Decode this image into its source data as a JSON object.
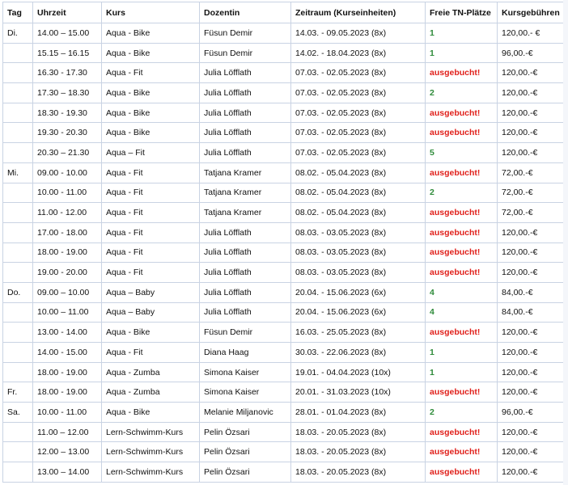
{
  "table": {
    "headers": {
      "day": "Tag",
      "time": "Uhrzeit",
      "course": "Kurs",
      "instructor": "Dozentin",
      "period": "Zeitraum (Kurseinheiten)",
      "spots": "Freie TN-Plätze",
      "fee": "Kursgebühren"
    },
    "rows": [
      {
        "day": "Di.",
        "time": "14.00 – 15.00",
        "course": "Aqua - Bike",
        "instructor": "Füsun Demir",
        "period": "14.03. - 09.05.2023 (8x)",
        "spots": "1",
        "fee": "120,00.- €",
        "status": "free"
      },
      {
        "day": "",
        "time": "15.15 – 16.15",
        "course": "Aqua - Bike",
        "instructor": "Füsun Demir",
        "period": "14.02. - 18.04.2023 (8x)",
        "spots": "1",
        "fee": "96,00.-€",
        "status": "free"
      },
      {
        "day": "",
        "time": "16.30 - 17.30",
        "course": "Aqua - Fit",
        "instructor": "Julia Löfflath",
        "period": "07.03. - 02.05.2023 (8x)",
        "spots": "ausgebucht!",
        "fee": "120,00.-€",
        "status": "full"
      },
      {
        "day": "",
        "time": "17.30 – 18.30",
        "course": "Aqua - Bike",
        "instructor": "Julia Löfflath",
        "period": "07.03. - 02.05.2023 (8x)",
        "spots": "2",
        "fee": "120,00.-€",
        "status": "free"
      },
      {
        "day": "",
        "time": "18.30 - 19.30",
        "course": "Aqua - Bike",
        "instructor": "Julia Löfflath",
        "period": "07.03. - 02.05.2023 (8x)",
        "spots": "ausgebucht!",
        "fee": "120,00.-€",
        "status": "full"
      },
      {
        "day": "",
        "time": "19.30 - 20.30",
        "course": "Aqua - Bike",
        "instructor": "Julia Löfflath",
        "period": "07.03. - 02.05.2023 (8x)",
        "spots": "ausgebucht!",
        "fee": "120,00.-€",
        "status": "full"
      },
      {
        "day": "",
        "time": "20.30 – 21.30",
        "course": "Aqua – Fit",
        "instructor": "Julia Löfflath",
        "period": "07.03. - 02.05.2023 (8x)",
        "spots": "5",
        "fee": "120,00.-€",
        "status": "free"
      },
      {
        "day": "Mi.",
        "time": "09.00 - 10.00",
        "course": "Aqua - Fit",
        "instructor": "Tatjana Kramer",
        "period": "08.02. - 05.04.2023 (8x)",
        "spots": "ausgebucht!",
        "fee": "72,00.-€",
        "status": "full"
      },
      {
        "day": "",
        "time": "10.00 - 11.00",
        "course": "Aqua - Fit",
        "instructor": "Tatjana Kramer",
        "period": "08.02. - 05.04.2023 (8x)",
        "spots": "2",
        "fee": "72,00.-€",
        "status": "free"
      },
      {
        "day": "",
        "time": "11.00 - 12.00",
        "course": "Aqua - Fit",
        "instructor": "Tatjana Kramer",
        "period": "08.02. - 05.04.2023 (8x)",
        "spots": "ausgebucht!",
        "fee": "72,00.-€",
        "status": "full"
      },
      {
        "day": "",
        "time": "17.00 - 18.00",
        "course": "Aqua - Fit",
        "instructor": "Julia Löfflath",
        "period": "08.03. - 03.05.2023 (8x)",
        "spots": "ausgebucht!",
        "fee": "120,00.-€",
        "status": "full"
      },
      {
        "day": "",
        "time": "18.00 - 19.00",
        "course": "Aqua - Fit",
        "instructor": "Julia Löfflath",
        "period": "08.03. - 03.05.2023 (8x)",
        "spots": "ausgebucht!",
        "fee": "120,00.-€",
        "status": "full"
      },
      {
        "day": "",
        "time": "19.00 - 20.00",
        "course": "Aqua - Fit",
        "instructor": "Julia Löfflath",
        "period": "08.03. - 03.05.2023 (8x)",
        "spots": "ausgebucht!",
        "fee": "120,00.-€",
        "status": "full"
      },
      {
        "day": "Do.",
        "time": "09.00 – 10.00",
        "course": "Aqua – Baby",
        "instructor": "Julia Löfflath",
        "period": "20.04. - 15.06.2023 (6x)",
        "spots": "4",
        "fee": "84,00.-€",
        "status": "free"
      },
      {
        "day": "",
        "time": "10.00 – 11.00",
        "course": "Aqua – Baby",
        "instructor": "Julia Löfflath",
        "period": "20.04. - 15.06.2023 (6x)",
        "spots": "4",
        "fee": "84,00.-€",
        "status": "free"
      },
      {
        "day": "",
        "time": "13.00 - 14.00",
        "course": "Aqua - Bike",
        "instructor": "Füsun Demir",
        "period": "16.03. - 25.05.2023 (8x)",
        "spots": "ausgebucht!",
        "fee": "120,00.-€",
        "status": "full"
      },
      {
        "day": "",
        "time": "14.00 - 15.00",
        "course": "Aqua - Fit",
        "instructor": "Diana Haag",
        "period": "30.03. - 22.06.2023 (8x)",
        "spots": "1",
        "fee": "120,00.-€",
        "status": "free"
      },
      {
        "day": "",
        "time": "18.00 - 19.00",
        "course": "Aqua - Zumba",
        "instructor": "Simona Kaiser",
        "period": "19.01. - 04.04.2023 (10x)",
        "spots": "1",
        "fee": "120,00.-€",
        "status": "free"
      },
      {
        "day": "Fr.",
        "time": "18.00 - 19.00",
        "course": "Aqua - Zumba",
        "instructor": "Simona Kaiser",
        "period": "20.01. - 31.03.2023 (10x)",
        "spots": "ausgebucht!",
        "fee": "120,00.-€",
        "status": "full"
      },
      {
        "day": "Sa.",
        "time": "10.00 - 11.00",
        "course": "Aqua - Bike",
        "instructor": "Melanie Miljanovic",
        "period": "28.01. - 01.04.2023 (8x)",
        "spots": "2",
        "fee": "96,00.-€",
        "status": "free"
      },
      {
        "day": "",
        "time": "11.00 – 12.00",
        "course": "Lern-Schwimm-Kurs",
        "instructor": "Pelin Özsari",
        "period": "18.03. - 20.05.2023 (8x)",
        "spots": "ausgebucht!",
        "fee": "120,00.-€",
        "status": "full"
      },
      {
        "day": "",
        "time": "12.00 – 13.00",
        "course": "Lern-Schwimm-Kurs",
        "instructor": "Pelin Özsari",
        "period": "18.03. - 20.05.2023 (8x)",
        "spots": "ausgebucht!",
        "fee": "120,00.-€",
        "status": "full"
      },
      {
        "day": "",
        "time": "13.00 – 14.00",
        "course": "Lern-Schwimm-Kurs",
        "instructor": "Pelin Özsari",
        "period": "18.03. - 20.05.2023 (8x)",
        "spots": "ausgebucht!",
        "fee": "120,00.-€",
        "status": "full"
      }
    ]
  },
  "colors": {
    "free_spots": "#2e8b3a",
    "booked_out": "#e0201b",
    "grid_border": "#c9d3e3"
  }
}
